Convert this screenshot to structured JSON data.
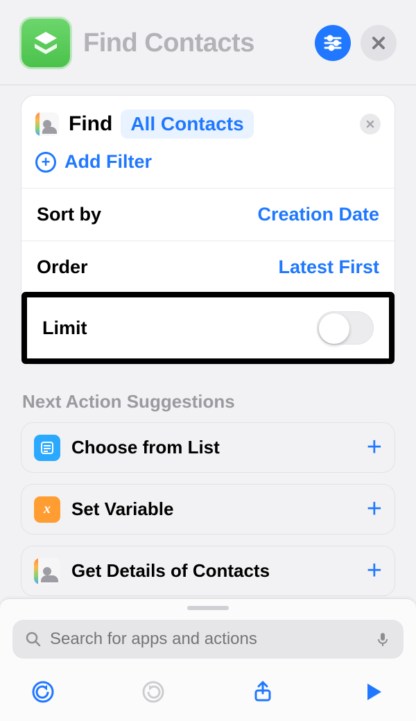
{
  "header": {
    "title": "Find Contacts"
  },
  "action": {
    "find_label": "Find",
    "target_pill": "All Contacts",
    "add_filter_label": "Add Filter",
    "sort_by_label": "Sort by",
    "sort_by_value": "Creation Date",
    "order_label": "Order",
    "order_value": "Latest First",
    "limit_label": "Limit",
    "limit_enabled": false
  },
  "suggestions": {
    "title": "Next Action Suggestions",
    "items": [
      {
        "label": "Choose from List"
      },
      {
        "label": "Set Variable"
      },
      {
        "label": "Get Details of Contacts"
      }
    ]
  },
  "search": {
    "placeholder": "Search for apps and actions"
  },
  "colors": {
    "accent_blue": "#1f78ff",
    "app_green": "#4bc24b"
  }
}
